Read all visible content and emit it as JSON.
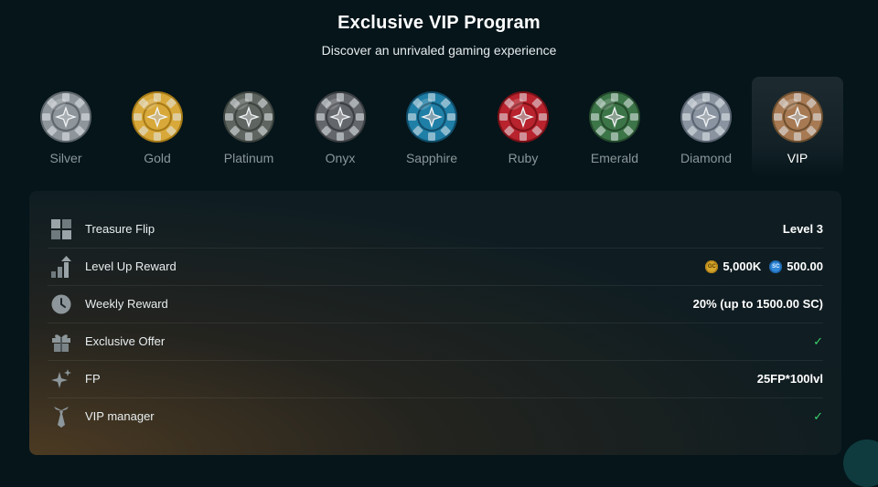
{
  "header": {
    "title": "Exclusive VIP Program",
    "subtitle": "Discover an unrivaled gaming experience"
  },
  "tiers": [
    {
      "name": "Silver",
      "color": "#8e969c",
      "rim": "#5d656b",
      "active": false
    },
    {
      "name": "Gold",
      "color": "#d8a93a",
      "rim": "#a77a16",
      "active": false
    },
    {
      "name": "Platinum",
      "color": "#5f6661",
      "rim": "#3d433f",
      "active": false
    },
    {
      "name": "Onyx",
      "color": "#63666a",
      "rim": "#3b3e42",
      "active": false
    },
    {
      "name": "Sapphire",
      "color": "#1f7fa6",
      "rim": "#0f4d6a",
      "active": false
    },
    {
      "name": "Ruby",
      "color": "#b8232d",
      "rim": "#7d1117",
      "active": false
    },
    {
      "name": "Emerald",
      "color": "#3c7547",
      "rim": "#244a2c",
      "active": false
    },
    {
      "name": "Diamond",
      "color": "#8a94a1",
      "rim": "#5a6370",
      "active": false
    },
    {
      "name": "VIP",
      "color": "#a77a54",
      "rim": "#70502f",
      "active": true
    }
  ],
  "benefits": [
    {
      "icon": "grid-icon",
      "label": "Treasure Flip",
      "value": "Level 3"
    },
    {
      "icon": "level-up-icon",
      "label": "Level Up Reward",
      "gc_label": "GC",
      "gc_value": "5,000K",
      "sc_label": "SC",
      "sc_value": "500.00"
    },
    {
      "icon": "clock-icon",
      "label": "Weekly Reward",
      "value": "20% (up to 1500.00 SC)"
    },
    {
      "icon": "gift-icon",
      "label": "Exclusive Offer",
      "value": "✓"
    },
    {
      "icon": "sparkle-icon",
      "label": "FP",
      "value": "25FP*100lvl"
    },
    {
      "icon": "tie-icon",
      "label": "VIP manager",
      "value": "✓"
    }
  ],
  "colors": {
    "background": "#05151a",
    "check": "#3bd36b",
    "muted_text": "#8a979b"
  }
}
